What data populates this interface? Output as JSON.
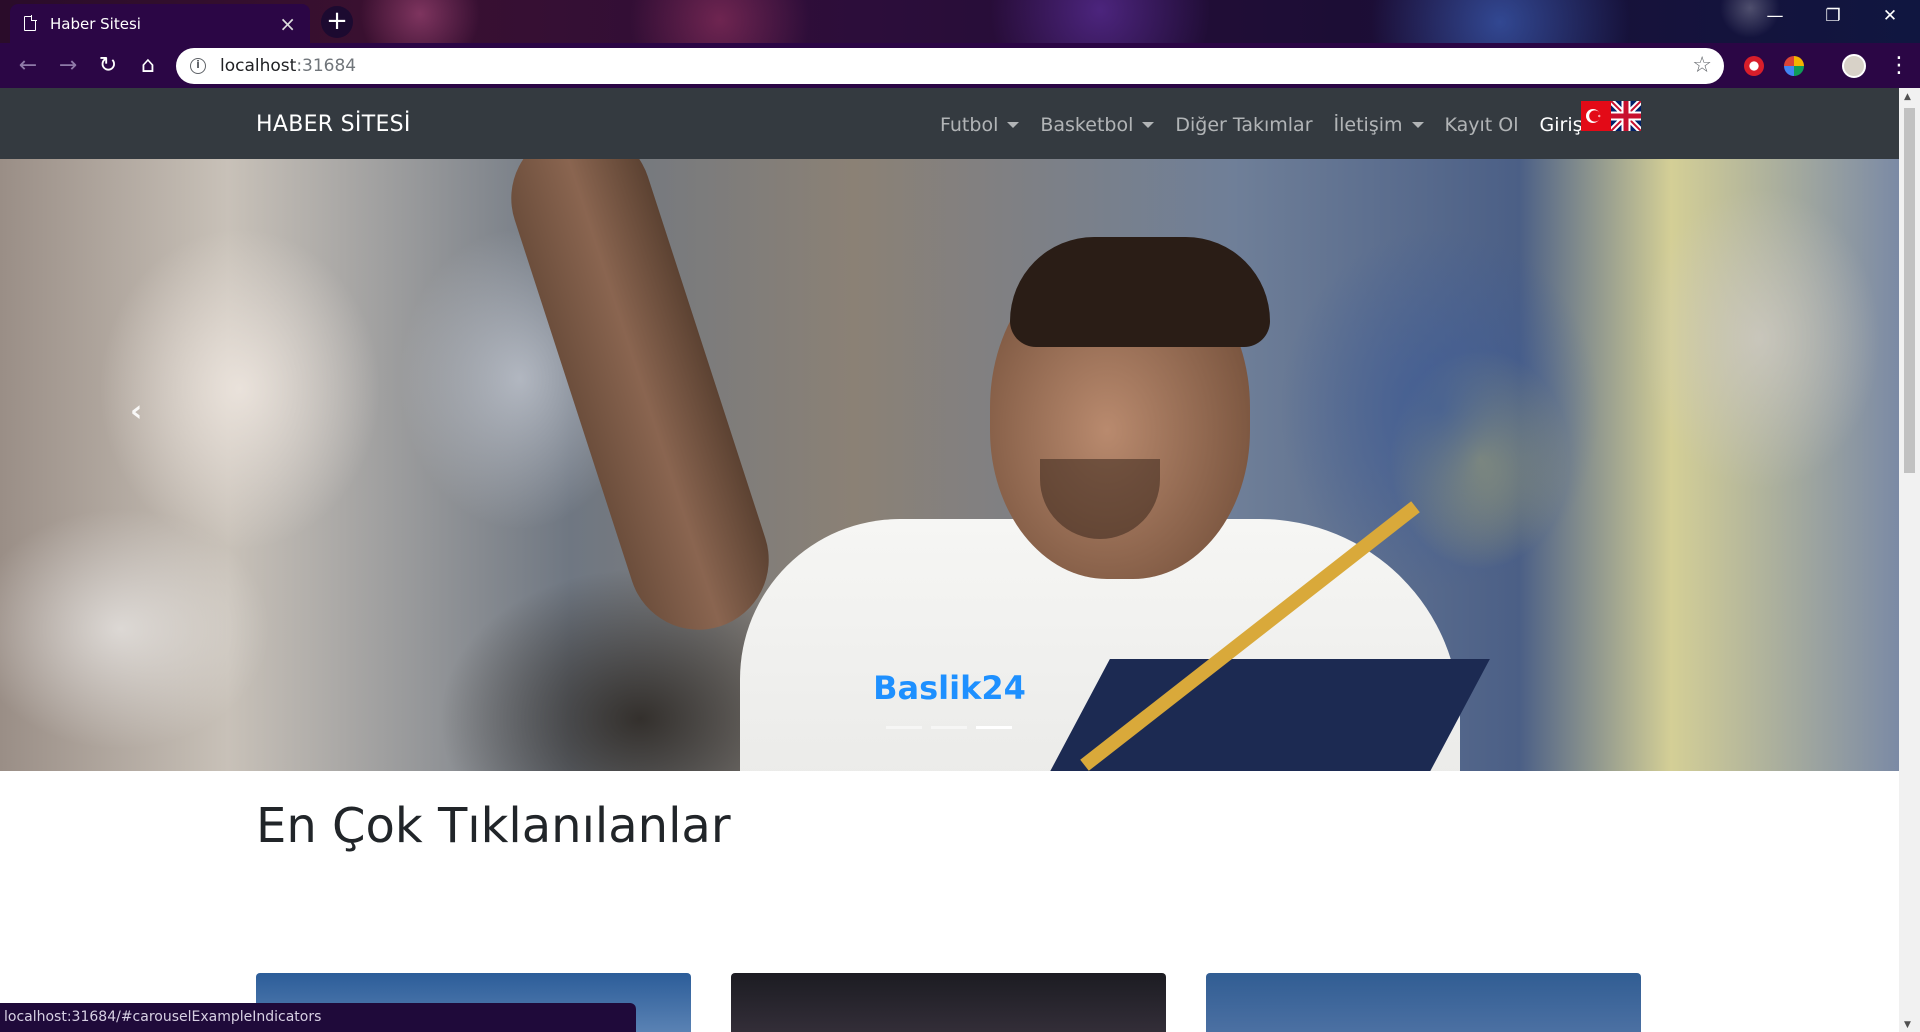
{
  "browser": {
    "tab_title": "Haber Sitesi",
    "tab_close": "×",
    "new_tab": "+",
    "url_host": "localhost",
    "url_port": ":31684",
    "status_url": "localhost:31684/#carouselExampleIndicators",
    "window_controls": {
      "minimize": "—",
      "restore": "❐",
      "close": "✕"
    },
    "nav": {
      "back": "←",
      "forward": "→",
      "reload": "↻",
      "home": "⌂"
    },
    "star": "☆",
    "menu": "⋮"
  },
  "site": {
    "brand": "HABER SİTESİ",
    "menu": [
      {
        "label": "Futbol",
        "dropdown": true
      },
      {
        "label": "Basketbol",
        "dropdown": true
      },
      {
        "label": "Diğer Takımlar",
        "dropdown": false
      },
      {
        "label": "İletişim",
        "dropdown": true
      },
      {
        "label": "Kayıt Ol",
        "dropdown": false
      },
      {
        "label": "Giriş",
        "dropdown": true,
        "active": true
      }
    ],
    "flags": [
      "turkey-flag-icon",
      "uk-flag-icon"
    ]
  },
  "carousel": {
    "prev_icon": "‹",
    "caption": "Baslik24",
    "caption_color": "#1e90ff",
    "indicators": 3,
    "active_indicator": 2
  },
  "main": {
    "section_title": "En Çok Tıklanılanlar",
    "cards": 3
  },
  "colors": {
    "chrome": "#2b0645",
    "navbar": "#343a40"
  }
}
